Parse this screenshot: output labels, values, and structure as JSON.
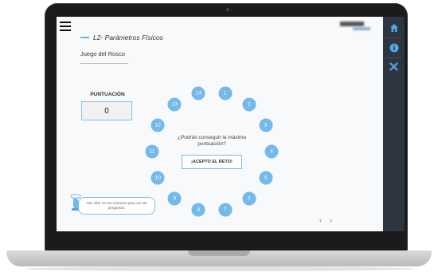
{
  "app": {
    "lesson_title": "L2- Parámetros Físicos",
    "subtitle": "Juego del Rosco"
  },
  "sidebar_right": {
    "buttons": [
      {
        "icon": "home-icon"
      },
      {
        "icon": "info-icon"
      },
      {
        "icon": "close-icon"
      }
    ]
  },
  "score": {
    "label": "PUNTUACIÓN",
    "value": "0"
  },
  "rosco": {
    "numbers": [
      "1",
      "2",
      "3",
      "4",
      "5",
      "6",
      "7",
      "8",
      "9",
      "10",
      "11",
      "12",
      "13",
      "14"
    ],
    "question": "¿Podrás conseguir la máxima puntuación?",
    "accept_label": "¡ACEPTO EL RETO!"
  },
  "hint": {
    "text": "Haz click en los números para ver las preguntas."
  },
  "pager": {
    "prev": "‹",
    "next": "›"
  },
  "colors": {
    "accent": "#74b9ec",
    "sidebar": "#2e3440"
  }
}
